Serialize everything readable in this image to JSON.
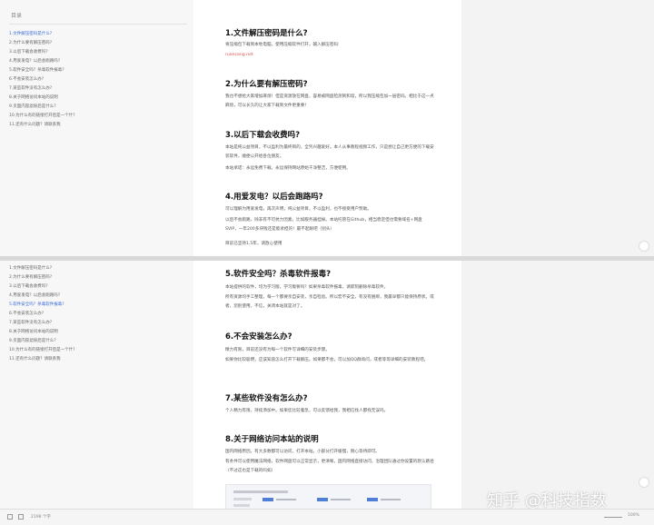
{
  "toc": {
    "title": "目录",
    "items": [
      "1.文件解压密码是什么?",
      "2.为什么要有解压密码?",
      "3.以后下载会收费吗?",
      "4.用爱发电？以后会跑路吗?",
      "5.软件安全吗？杀毒软件报毒?",
      "6.不会安装怎么办?",
      "7.某些软件没有怎么办?",
      "8.关于网络访问本站的说明",
      "9.页面内容滤除后是什么?",
      "10.为什么有的链接打开后是一个什?",
      "11.还有什么问题？请联系我"
    ]
  },
  "sections_top": [
    {
      "title": "1.文件解压密码是什么?",
      "paras": [
        "将压缩包下载到本地电脑，使用压缩软件打开，输入解压密码:"
      ],
      "link": "ruancang.net"
    },
    {
      "title": "2.为什么要有解压密码?",
      "paras": [
        "我也不想给大家增加麻烦！但是资源放在网盘，容易被网盘检测到和谐，所以我压缩包加一层密码。相比于这一点麻烦，可以长久的让大家下载到文件更重要！"
      ]
    },
    {
      "title": "3.以后下载会收费吗?",
      "paras": [
        "本站是纯公益项目，不以盈利为最终目的，全凭兴趣爱好。本人从事教程视频工作，只是想让自己更方便的下载安装软件，顺便公开给各位朋友。",
        "本站承诺：永远免费下载，永远保持网站原始干净整洁，方便使用。"
      ]
    },
    {
      "title": "4.用爱发电？以后会跑路吗?",
      "paras": [
        "可以理解为用爱发电，再次声明，纯公益项目，不以盈利，也不接受用户赞助。",
        "以后不会跑路，除非有不可抗力因素，比如服务器挂掉。本站托管在Github，相当稳定但也需要域名+网盘SVIP，一年200多块钱还是能承担的！最不起眼吧（别头）",
        "目前已坚持1.5年，请放心使用"
      ]
    }
  ],
  "sections_bottom": [
    {
      "title": "5.软件安全吗？杀毒软件报毒?",
      "paras": [
        "本站提供的软件，均为学习版。学习版要吗？如果杀毒软件报毒，请即刻删除杀毒软件。",
        "所有资源均手工整理，每一个都要亲自安装，亲自检验。所以宏不安全，有没有捆绑，我最早都只能保持原状。或者，您别使用，不信，关闭本站就是对了。"
      ]
    },
    {
      "title": "6.不会安装怎么办?",
      "paras": [
        "精力有限，目前还没有为每一个软件写详细的安装步骤。",
        "如果你比较聪明，应该知道怎么打开下载解压。如果都不会，可以加QQ群询问，或者等等详细的安装教程吧。"
      ]
    },
    {
      "title": "7.某些软件没有怎么办?",
      "paras": [
        "个人精力有限，持续添加中。如果您比较着急，可以反馈给我，我相信找人都找无误吗。"
      ]
    },
    {
      "title": "8.关于网络访问本站的说明",
      "paras": [
        "国内网络原因，有大多数都可以访问，打开本站。小部分打开缓慢，耐心等待即可。",
        "有条件可以使用魔法网络，软件网盘可以正常显示，更清晰。国内网络直接访问，治理团队通过你设置的默认路径（不过这也是下载的吗如）"
      ]
    }
  ],
  "preview": {
    "brand_color": "#4f7ed6"
  },
  "status": {
    "left_text": "2198 个字",
    "zoom": "100%"
  },
  "watermark": "知乎 @科技指数",
  "colors": {
    "toc_active": "#3b6bd8",
    "link": "#d9534f"
  }
}
